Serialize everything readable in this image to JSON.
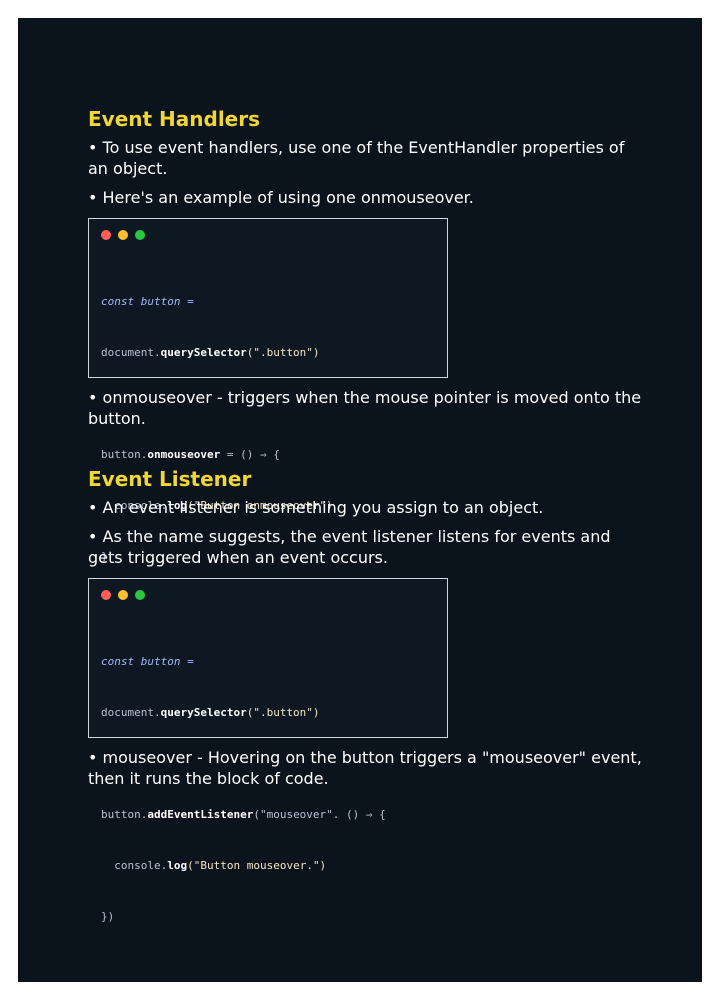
{
  "sections": [
    {
      "title": "Event Handlers",
      "bullets": [
        "• To use event handlers, use one of the EventHandler properties of an object.",
        "• Here's an example of using one onmouseover."
      ],
      "code": {
        "line1": "const button =",
        "line2a": "document.",
        "line2b": "querySelector",
        "line2c": "(\".button\")",
        "line4a": "button.",
        "line4b": "onmouseover",
        "line4c": " = () ⇒ {",
        "line5a": "  console.",
        "line5b": "log",
        "line5c": "(\"Button onmouseover\")",
        "line6": "}"
      },
      "note": "• onmouseover - triggers when the mouse pointer is moved onto the button."
    },
    {
      "title": "Event Listener",
      "bullets": [
        "• An event listener is something you assign to an object.",
        "• As the name suggests, the event listener listens for events and gets triggered when an event occurs."
      ],
      "code": {
        "line1": "const button =",
        "line2a": "document.",
        "line2b": "querySelector",
        "line2c": "(\".button\")",
        "line4a": "button.",
        "line4b": "addEventListener",
        "line4c": "(\"mouseover\". () ⇒ {",
        "line5a": "  console.",
        "line5b": "log",
        "line5c": "(\"Button mouseover.\")",
        "line6": "})"
      },
      "note": "• mouseover - Hovering on the button triggers a \"mouseover\" event, then it runs the block of code."
    }
  ]
}
